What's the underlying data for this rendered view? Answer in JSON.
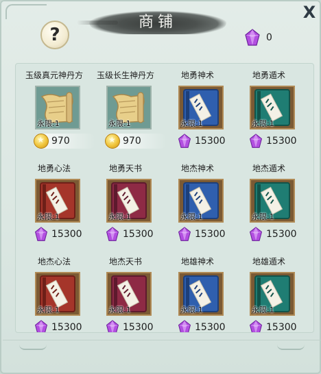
{
  "title": "商铺",
  "help_label": "?",
  "close_label": "X",
  "currency": {
    "value": "0",
    "icon": "purple-gem-icon"
  },
  "colors": {
    "blue_book": "#2f5fae",
    "teal_book": "#1f7d73",
    "red_book": "#a5352a",
    "maroon_book": "#8e2a45",
    "gem": "#b050d8",
    "coin": "#f0c43a"
  },
  "items": [
    {
      "name": "玉级真元神丹方",
      "limit": "永限:1",
      "price": "970",
      "currency": "coin",
      "art": "scroll"
    },
    {
      "name": "玉级长生神丹方",
      "limit": "永限:1",
      "price": "970",
      "currency": "coin",
      "art": "scroll"
    },
    {
      "name": "地勇神术",
      "limit": "永限:1",
      "price": "15300",
      "currency": "gem",
      "art": "blue"
    },
    {
      "name": "地勇遁术",
      "limit": "永限:1",
      "price": "15300",
      "currency": "gem",
      "art": "teal"
    },
    {
      "name": "地勇心法",
      "limit": "永限:1",
      "price": "15300",
      "currency": "gem",
      "art": "red"
    },
    {
      "name": "地勇天书",
      "limit": "永限:1",
      "price": "15300",
      "currency": "gem",
      "art": "maroon"
    },
    {
      "name": "地杰神术",
      "limit": "永限:1",
      "price": "15300",
      "currency": "gem",
      "art": "blue"
    },
    {
      "name": "地杰遁术",
      "limit": "永限:1",
      "price": "15300",
      "currency": "gem",
      "art": "teal"
    },
    {
      "name": "地杰心法",
      "limit": "永限:1",
      "price": "15300",
      "currency": "gem",
      "art": "red"
    },
    {
      "name": "地杰天书",
      "limit": "永限:1",
      "price": "15300",
      "currency": "gem",
      "art": "maroon"
    },
    {
      "name": "地雄神术",
      "limit": "永限:1",
      "price": "15300",
      "currency": "gem",
      "art": "blue"
    },
    {
      "name": "地雄遁术",
      "limit": "永限:1",
      "price": "15300",
      "currency": "gem",
      "art": "teal"
    }
  ]
}
